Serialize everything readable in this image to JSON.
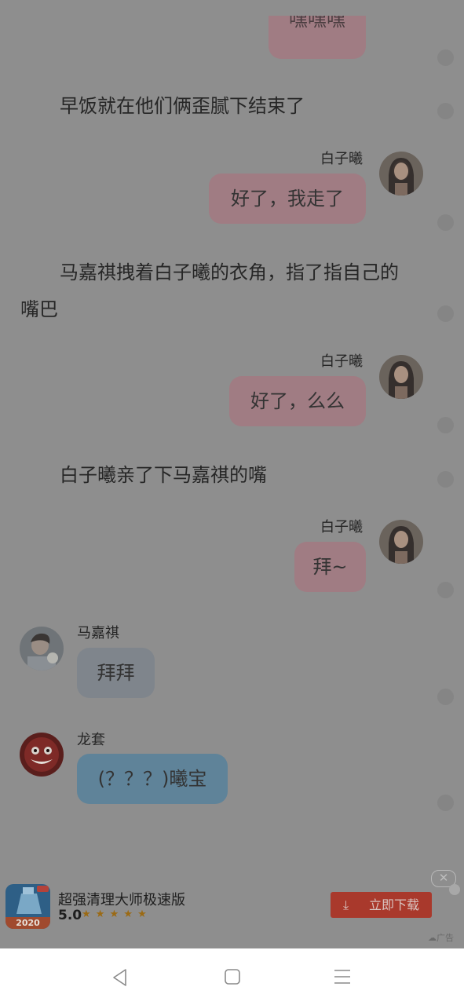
{
  "messages": {
    "top_partial": "嘿嘿嘿",
    "narr1": "早饭就在他们俩歪腻下结束了",
    "name1": "白子曦",
    "bubble1": "好了，我走了",
    "narr2_line1": "马嘉祺拽着白子曦的衣角，指了指自己的",
    "narr2_line2": "嘴巴",
    "name2": "白子曦",
    "bubble2": "好了，么么",
    "narr3": "白子曦亲了下马嘉祺的嘴",
    "name3": "白子曦",
    "bubble3": "拜~",
    "name4": "马嘉祺",
    "bubble4": "拜拜",
    "name5": "龙套",
    "bubble5": "(？？？)曦宝"
  },
  "ad": {
    "title": "超强清理大师极速版",
    "rating": "5.0",
    "stars": "★ ★ ★ ★ ★",
    "icon_year": "2020",
    "download_label": "立即下载",
    "ad_label": "广告"
  },
  "colors": {
    "bubble_pink": "#a07c83",
    "bubble_gray": "#7f858c",
    "bubble_blue": "#5f8399",
    "download_red": "#a9392c"
  }
}
